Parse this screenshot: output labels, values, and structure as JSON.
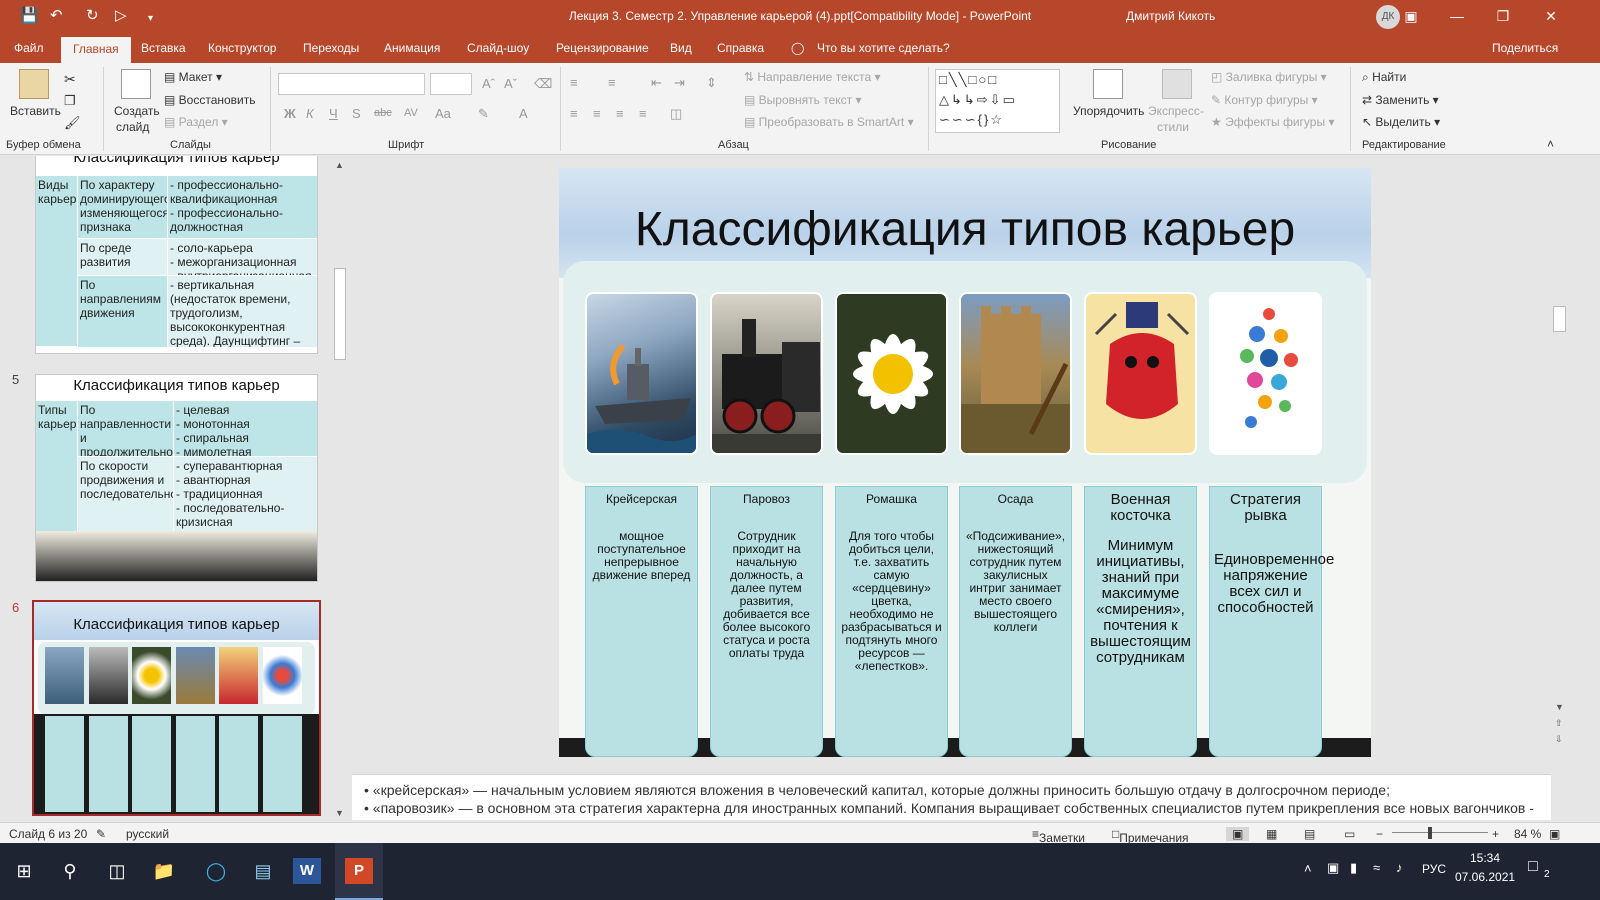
{
  "titlebar": {
    "title": "Лекция 3. Семестр 2. Управление карьерой (4).ppt[Compatibility Mode]  -  PowerPoint",
    "user": "Дмитрий Кикоть",
    "avatar": "ДК"
  },
  "tabs": [
    "Файл",
    "Главная",
    "Вставка",
    "Конструктор",
    "Переходы",
    "Анимация",
    "Слайд-шоу",
    "Рецензирование",
    "Вид",
    "Справка"
  ],
  "tell_me": "Что вы хотите сделать?",
  "share": "Поделиться",
  "ribbon": {
    "clipboard": {
      "paste": "Вставить",
      "label": "Буфер обмена"
    },
    "slides": {
      "new_slide": "Создать",
      "new_slide2": "слайд",
      "layout": "Макет",
      "reset": "Восстановить",
      "section": "Раздел",
      "label": "Слайды"
    },
    "font": {
      "label": "Шрифт"
    },
    "paragraph": {
      "text_direction": "Направление текста",
      "align_text": "Выровнять текст",
      "smartart": "Преобразовать в SmartArt",
      "label": "Абзац"
    },
    "drawing": {
      "arrange": "Упорядочить",
      "quick_styles": "Экспресс-",
      "quick_styles2": "стили",
      "fill": "Заливка фигуры",
      "outline": "Контур фигуры",
      "effects": "Эффекты фигуры",
      "label": "Рисование"
    },
    "editing": {
      "find": "Найти",
      "replace": "Заменить",
      "select": "Выделить",
      "label": "Редактирование"
    }
  },
  "thumbnails": {
    "slide4": {
      "title": "Классификация типов карьер",
      "rows": [
        {
          "c1": "Виды карьеры",
          "c2": "По характеру доминирующего изменяющегося признака",
          "c3": "- профессионально-квалификационная\n- профессионально-должностная\n- статусная\n- монетарная"
        },
        {
          "c1": "",
          "c2": "По среде развития",
          "c3": "- соло-карьера\n- межорганизационная\n- внутриорганизационная"
        },
        {
          "c1": "",
          "c2": "По направлениям движения",
          "c3": "- вертикальная (недостаток времени, трудоголизм, высококонкурентная среда). Даунщифтинг – вариант вертикальной карьеры с понижением\n- горизонтальная\n- ступенчатая\n- центростремительная (скрытая)"
        }
      ]
    },
    "slide5": {
      "number": "5",
      "title": "Классификация типов карьер",
      "rows": [
        {
          "c1": "Типы карьеры",
          "c2": "По направленности и продолжительности ступеней (С.И. Сотникова)",
          "c3": "- целевая\n- монотонная\n- спиральная\n- мимолетная\n- стабилизационная\n- затухающая"
        },
        {
          "c1": "",
          "c2": "По скорости продвижения и последовательности",
          "c3": "- суперавантюрная\n- авантюрная\n- традиционная\n- последовательно-кризисная\n- прагматичная (структурная)\n- отбывающая\n- преобразующая\n- эволюционная"
        }
      ]
    },
    "slide6": {
      "number": "6",
      "title": "Классификация типов карьер"
    }
  },
  "slide": {
    "title": "Классификация типов карьер",
    "cards": [
      {
        "heading": "Крейсерская",
        "body": "мощное поступательное непрерывное движение вперед"
      },
      {
        "heading": "Паровоз",
        "body": "Сотрудник приходит на начальную должность, а далее путем развития, добивается все более высокого статуса и роста оплаты труда"
      },
      {
        "heading": "Ромашка",
        "body": "Для того чтобы добиться цели, т.е. захватить самую «сердцевину» цветка, необходимо не разбрасываться и подтянуть много ресурсов — «лепестков»."
      },
      {
        "heading": "Осада",
        "body": "«Подсиживание», нижестоящий сотрудник путем закулисных интриг занимает место своего вышестоящего коллеги"
      },
      {
        "heading": "Военная косточка",
        "body": "Минимум инициативы, знаний при максимуме «смирения», почтения к вышестоящим сотрудникам"
      },
      {
        "heading": "Стратегия рывка",
        "body": "Единовременное напряжение всех сил и способностей"
      }
    ],
    "pic_labels": [
      "cruiser-picture",
      "locomotive-picture",
      "daisy-picture",
      "siege-picture",
      "soldier-picture",
      "social-picture"
    ]
  },
  "notes": {
    "line1": "• «крейсерская» — начальным условием являются вложения в человеческий капитал, которые должны приносить большую отдачу в долгосрочном периоде;",
    "line2": "• «паровозик» — в основном эта стратегия характерна для иностранных компаний. Компания выращивает собственных специалистов путем прикрепления все новых вагончиков - знаний, навыков и умений;"
  },
  "status": {
    "slide_counter": "Слайд 6 из 20",
    "language": "русский",
    "notes": "Заметки",
    "comments": "Примечания",
    "zoom": "84 %"
  },
  "taskbar": {
    "lang": "РУС",
    "time": "15:34",
    "date": "07.06.2021",
    "notif": "2"
  },
  "colors": {
    "accent": "#b7472a",
    "card": "#b9e1e3",
    "taskbar": "#1f2433"
  }
}
